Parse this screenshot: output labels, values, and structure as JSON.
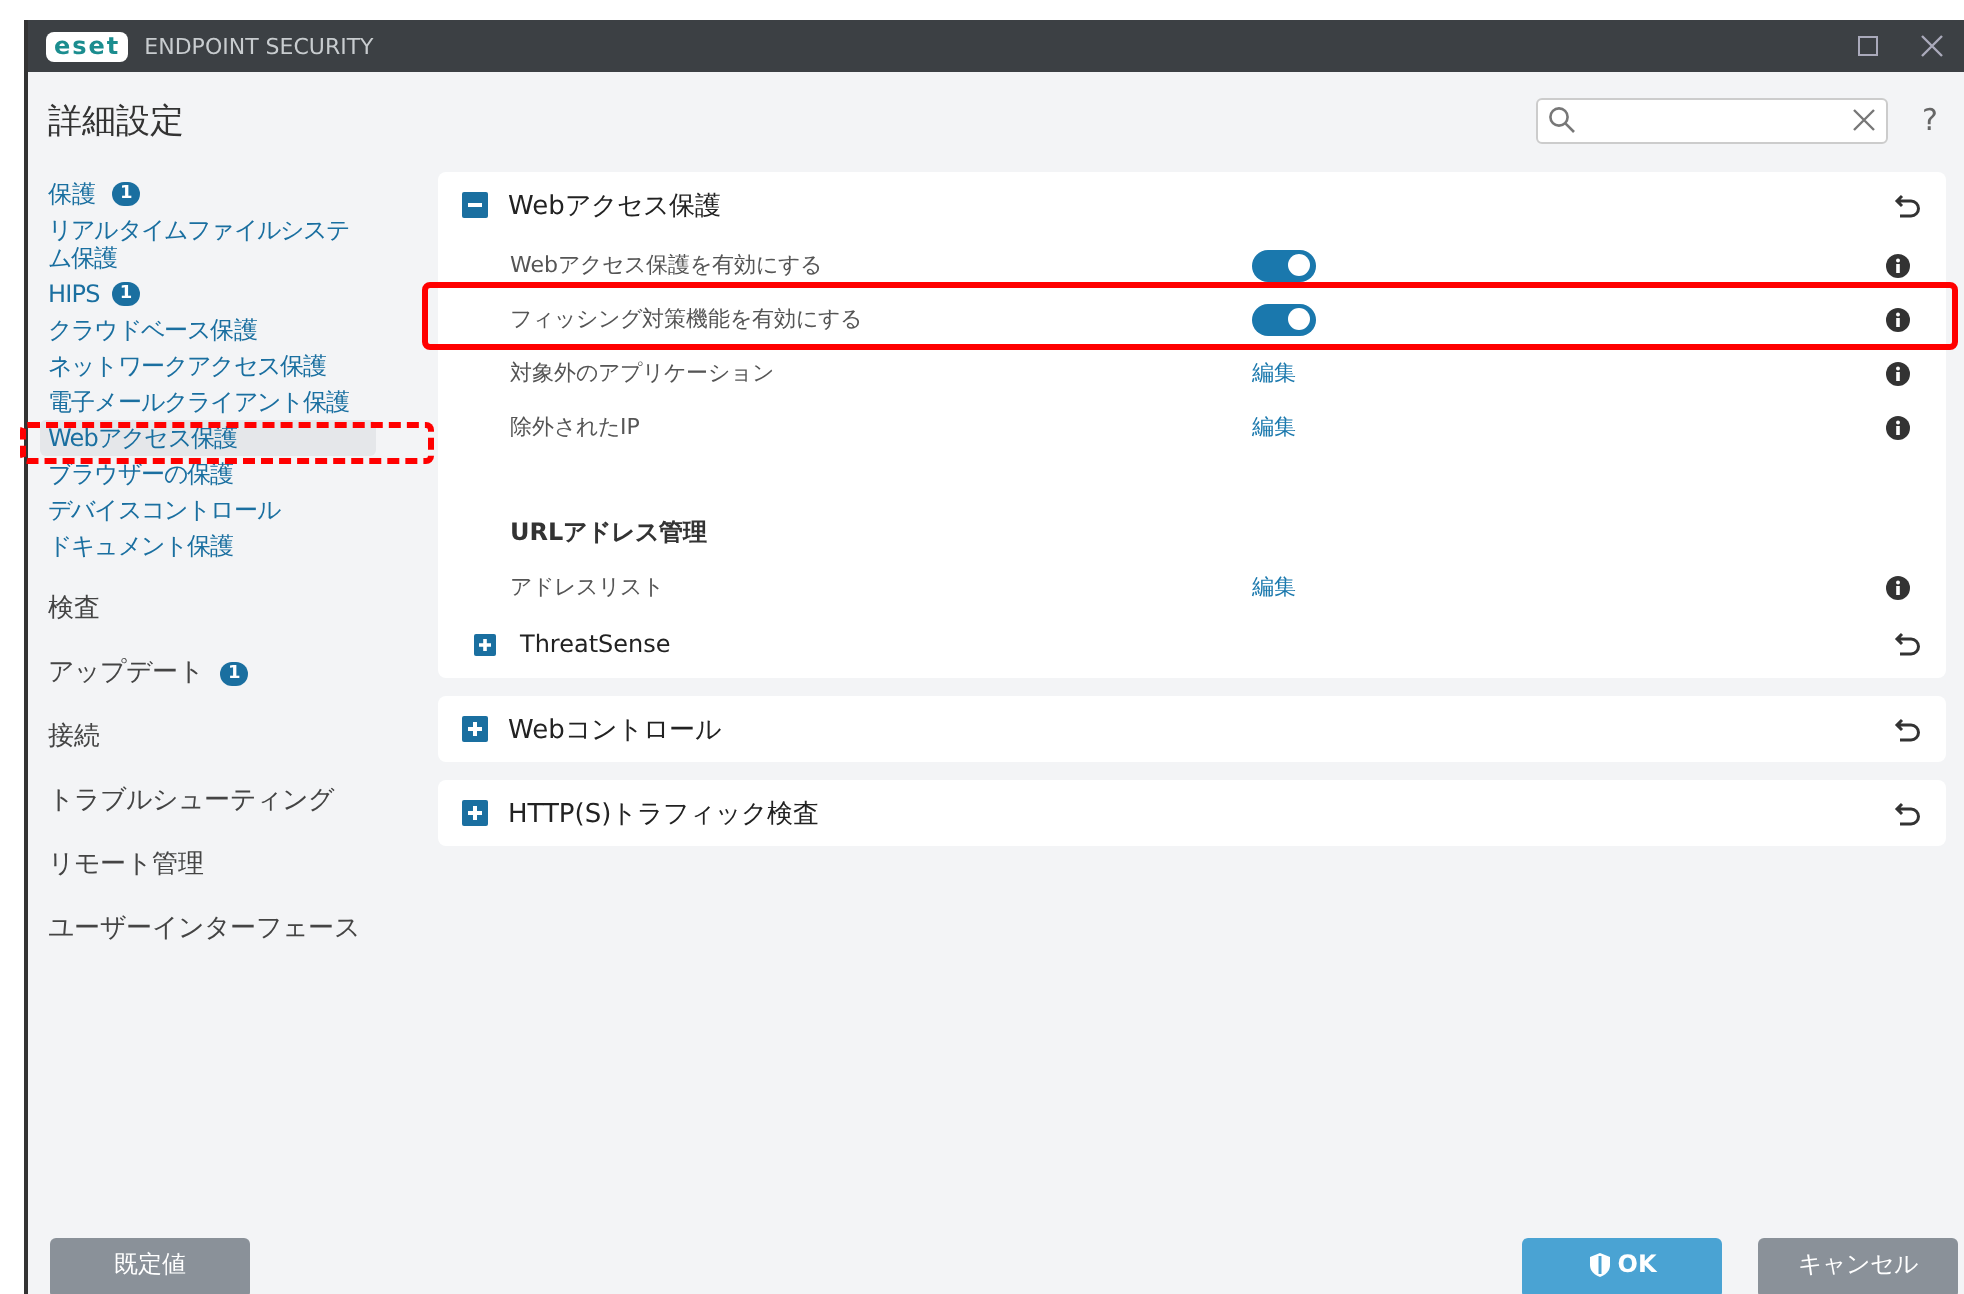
{
  "window": {
    "logo": "eset",
    "title": "ENDPOINT SECURITY"
  },
  "header": {
    "title": "詳細設定",
    "help": "?"
  },
  "sidebar": {
    "items": [
      {
        "label": "保護",
        "badge": "1",
        "children": [
          {
            "label": "リアルタイムファイルシステム保護",
            "selected": false
          },
          {
            "label": "HIPS",
            "badge": "1",
            "selected": false
          },
          {
            "label": "クラウドベース保護",
            "selected": false
          },
          {
            "label": "ネットワークアクセス保護",
            "selected": false
          },
          {
            "label": "電子メールクライアント保護",
            "selected": false
          },
          {
            "label": "Webアクセス保護",
            "selected": true
          },
          {
            "label": "ブラウザーの保護",
            "selected": false
          },
          {
            "label": "デバイスコントロール",
            "selected": false
          },
          {
            "label": "ドキュメント保護",
            "selected": false
          }
        ]
      },
      {
        "label": "検査"
      },
      {
        "label": "アップデート",
        "badge": "1"
      },
      {
        "label": "接続"
      },
      {
        "label": "トラブルシューティング"
      },
      {
        "label": "リモート管理"
      },
      {
        "label": "ユーザーインターフェース"
      }
    ]
  },
  "sections": [
    {
      "title": "Webアクセス保護",
      "expanded": true,
      "rows": [
        {
          "kind": "toggle",
          "label": "Webアクセス保護を有効にする",
          "on": true
        },
        {
          "kind": "toggle",
          "label": "フィッシング対策機能を有効にする",
          "on": true
        },
        {
          "kind": "link",
          "label": "対象外のアプリケーション",
          "link": "編集"
        },
        {
          "kind": "link",
          "label": "除外されたIP",
          "link": "編集"
        },
        {
          "kind": "spacer"
        },
        {
          "kind": "heading",
          "label": "URLアドレス管理"
        },
        {
          "kind": "link",
          "label": "アドレスリスト",
          "link": "編集"
        }
      ],
      "subsections": [
        {
          "title": "ThreatSense",
          "expanded": false
        }
      ]
    },
    {
      "title": "Webコントロール",
      "expanded": false
    },
    {
      "title": "HTTP(S)トラフィック検査",
      "expanded": false
    }
  ],
  "annotations": [
    {
      "kind": "solid"
    },
    {
      "kind": "dashed"
    }
  ],
  "buttons": [
    {
      "label": "既定値",
      "kind": "default"
    },
    {
      "label": "OK",
      "kind": "primary"
    },
    {
      "label": "キャンセル",
      "kind": "default"
    }
  ]
}
